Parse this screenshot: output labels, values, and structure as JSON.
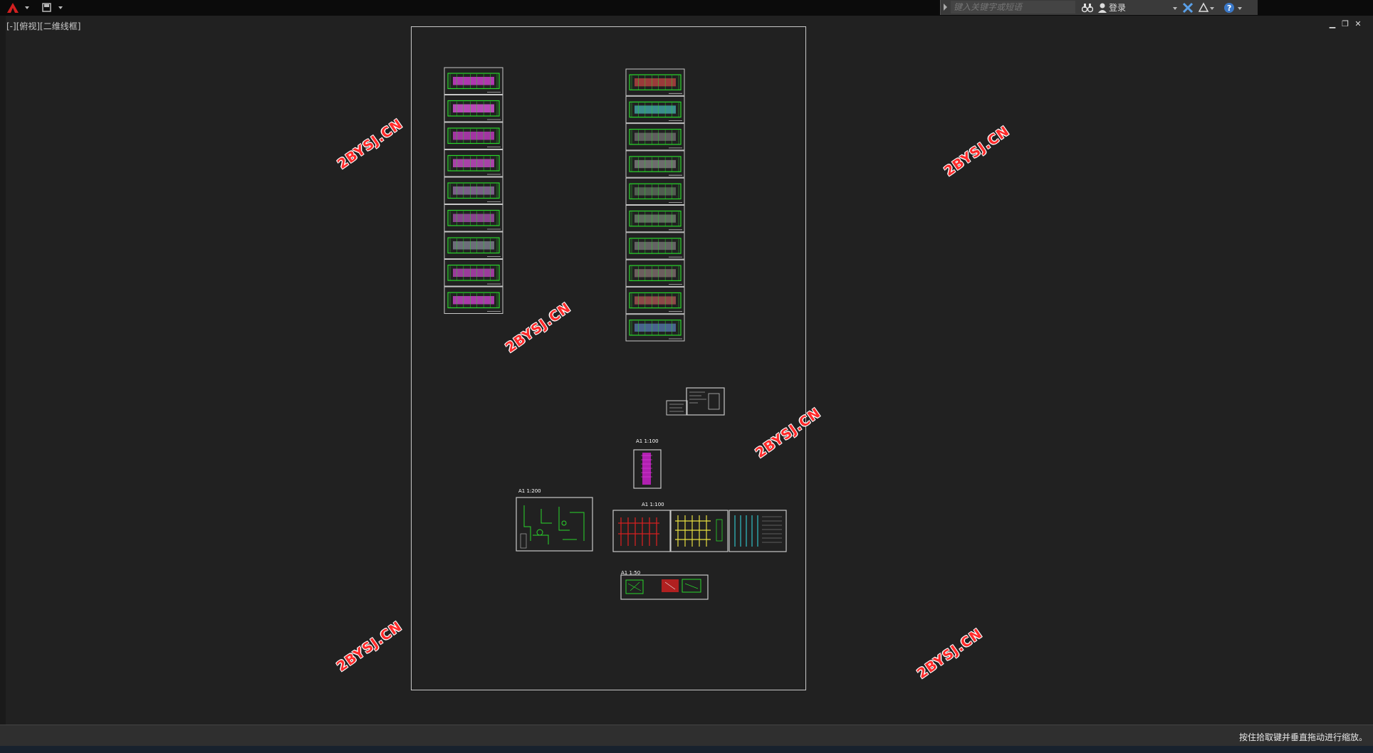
{
  "search": {
    "placeholder": "键入关键字或短语"
  },
  "toolbar": {
    "login_label": "登录"
  },
  "viewport": {
    "label": "[-][俯视][二维线框]"
  },
  "watermarks": [
    "2BYSJ.CN",
    "2BYSJ.CN",
    "2BYSJ.CN",
    "2BYSJ.CN",
    "2BYSJ.CN",
    "2BYSJ.CN"
  ],
  "status": {
    "message": "按住拾取键并垂直拖动进行缩放。"
  },
  "drawing": {
    "scale_labels": [
      "A1  1:100",
      "A1  1:200",
      "A1  1:100",
      "A1  1:50"
    ]
  },
  "colors": {
    "background": "#212121",
    "accent_red": "#d32020",
    "sheet_border": "#c8c8c8",
    "cad_green": "#29d62b",
    "cad_magenta": "#e040e0"
  }
}
